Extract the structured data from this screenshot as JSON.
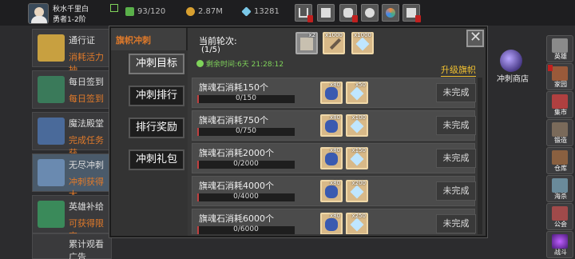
{
  "player": {
    "name": "秋水千里白",
    "rank": "勇者1-2阶"
  },
  "resources": [
    {
      "name": "stamina",
      "value": "93/120",
      "color": "#5ab04a",
      "icon": "leaf-icon"
    },
    {
      "name": "gold",
      "value": "2.87M",
      "color": "#d8a030",
      "icon": "coin-icon"
    },
    {
      "name": "gems",
      "value": "13281",
      "color": "#7ac8e8",
      "icon": "diamond-icon"
    }
  ],
  "top_buttons": [
    "shop-cart-icon",
    "mail-icon",
    "gamepad-icon",
    "settings-icon",
    "event-icon",
    "notice-icon"
  ],
  "left_items": [
    {
      "title": "通行证",
      "sub": "消耗活力抽",
      "color": "#c8a040"
    },
    {
      "title": "每日签到",
      "sub": "每日签到",
      "color": "#3a7a5a"
    },
    {
      "title": "魔法殿堂",
      "sub": "完成任务获",
      "color": "#4a6a9a"
    },
    {
      "title": "无尽冲刺",
      "sub": "冲刺获得大",
      "color": "#6a8ab0"
    },
    {
      "title": "英雄补给",
      "sub": "可获得限定",
      "color": "#3a8a5a"
    }
  ],
  "bottom_ad": {
    "title": "累计观看广告"
  },
  "right_buttons": [
    "英雄",
    "家园",
    "集市",
    "锻造",
    "仓库",
    "海杀",
    "公会",
    "战斗"
  ],
  "shop_label": "冲刺商店",
  "modal": {
    "title": "旗帜冲刺",
    "tabs": [
      "冲刺目标",
      "冲刺排行",
      "排行奖励",
      "冲刺礼包"
    ],
    "round_label": "当前轮次:",
    "round_value": "(1/5)",
    "round_rewards": [
      {
        "qty": "x2",
        "icon": "scroll-icon"
      },
      {
        "qty": "x1000",
        "icon": "staff-icon"
      },
      {
        "qty": "x1000",
        "icon": "diamond-icon"
      }
    ],
    "timer": "剩余时间:6天 21:28:12",
    "upgrade": "升级旗帜",
    "close": "✕",
    "rows": [
      {
        "title": "旗魂石消耗150个",
        "progress": "0/150",
        "fraction": 0.02,
        "r1": "x80",
        "r2": "x50",
        "status": "未完成"
      },
      {
        "title": "旗魂石消耗750个",
        "progress": "0/750",
        "fraction": 0.02,
        "r1": "x80",
        "r2": "x100",
        "status": "未完成"
      },
      {
        "title": "旗魂石消耗2000个",
        "progress": "0/2000",
        "fraction": 0.02,
        "r1": "x80",
        "r2": "x150",
        "status": "未完成"
      },
      {
        "title": "旗魂石消耗4000个",
        "progress": "0/4000",
        "fraction": 0.02,
        "r1": "x80",
        "r2": "x200",
        "status": "未完成"
      },
      {
        "title": "旗魂石消耗6000个",
        "progress": "0/6000",
        "fraction": 0.02,
        "r1": "x80",
        "r2": "x250",
        "status": "未完成"
      }
    ]
  }
}
